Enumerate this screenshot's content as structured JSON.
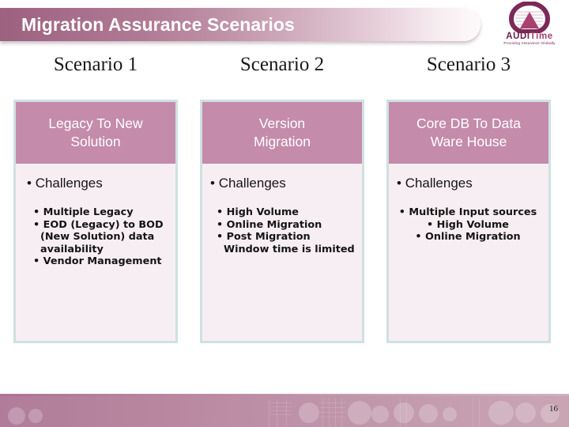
{
  "slide": {
    "title": "Migration Assurance Scenarios",
    "page_number": "16",
    "accent_color": "#9c617f",
    "header_box_color": "#c48bab",
    "column_bg_color": "#f7eef3",
    "column_border_color": "#cfe1e1"
  },
  "logo": {
    "wordmark_audi": "AUDI",
    "wordmark_time": "Time",
    "tagline": "Providing Assurance Globally",
    "mark_color": "#7b2a58"
  },
  "columns": [
    {
      "scenario_label": "Scenario 1",
      "header": "Legacy To New\nSolution",
      "section_label": "Challenges",
      "bullets": [
        "Multiple Legacy",
        "EOD (Legacy) to BOD (New Solution) data availability",
        "Vendor Management"
      ]
    },
    {
      "scenario_label": "Scenario 2",
      "header": "Version\nMigration",
      "section_label": "Challenges",
      "bullets": [
        "High Volume",
        "Online Migration",
        "Post Migration Window time is limited"
      ]
    },
    {
      "scenario_label": "Scenario 3",
      "header": "Core DB To Data\nWare House",
      "section_label": "Challenges",
      "bullets": [
        "Multiple Input sources",
        "High Volume",
        "Online Migration"
      ]
    }
  ]
}
